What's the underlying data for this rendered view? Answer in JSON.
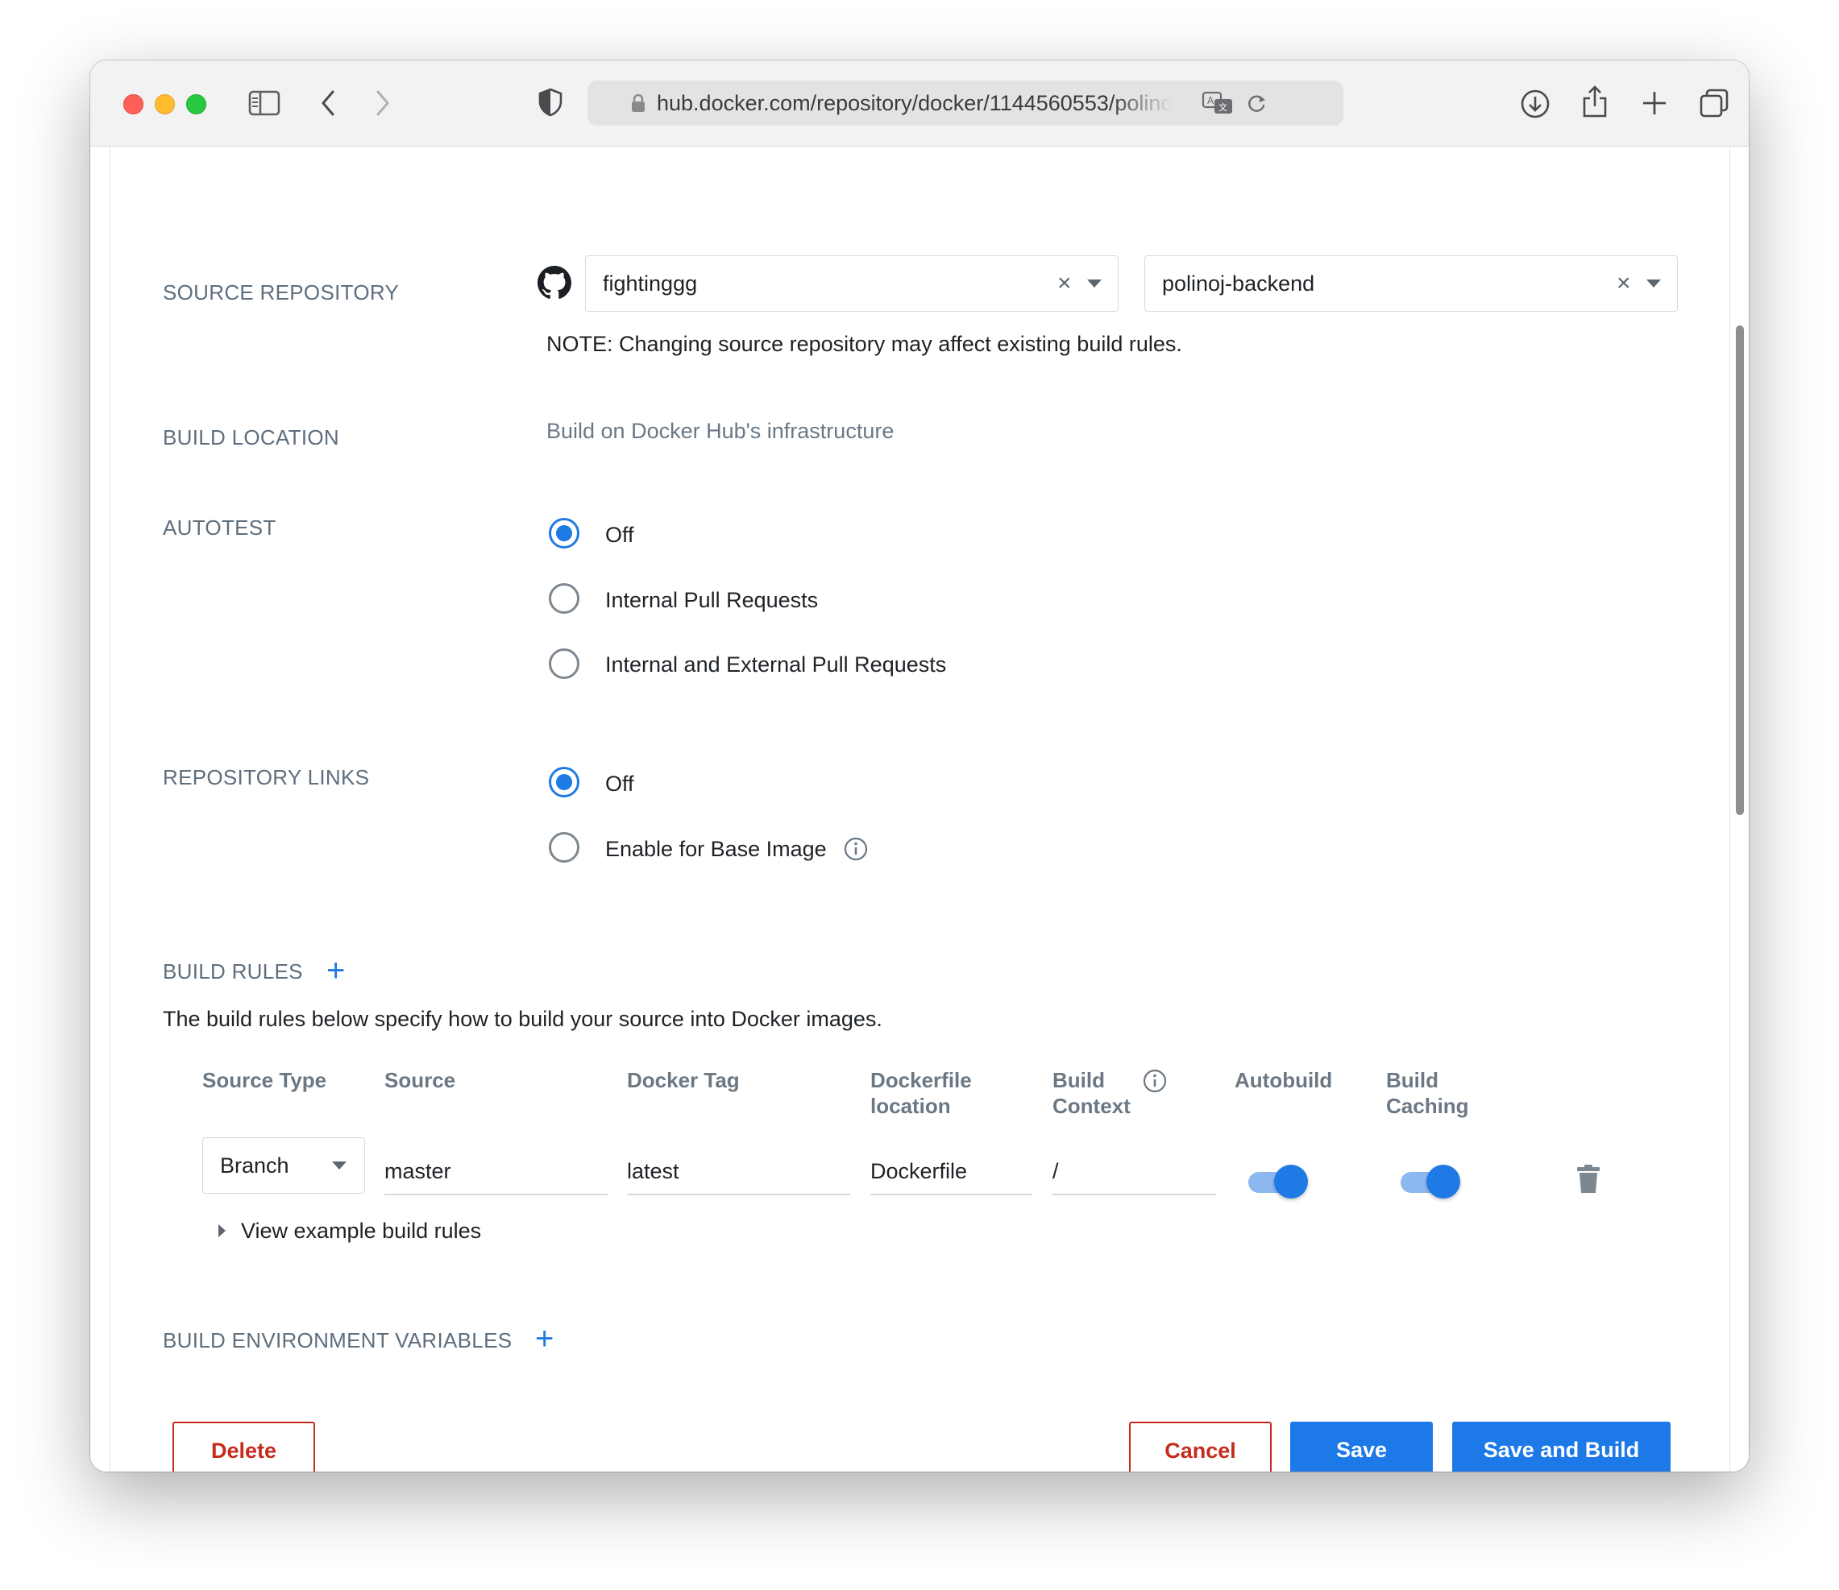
{
  "browser": {
    "url": "hub.docker.com/repository/docker/1144560553/polinoj-backend"
  },
  "source_repository": {
    "label": "SOURCE REPOSITORY",
    "organization": "fightinggg",
    "repository": "polinoj-backend",
    "note": "NOTE: Changing source repository may affect existing build rules."
  },
  "build_location": {
    "label": "BUILD LOCATION",
    "value": "Build on Docker Hub's infrastructure"
  },
  "autotest": {
    "label": "AUTOTEST",
    "options": [
      {
        "label": "Off",
        "selected": true
      },
      {
        "label": "Internal Pull Requests",
        "selected": false
      },
      {
        "label": "Internal and External Pull Requests",
        "selected": false
      }
    ]
  },
  "repository_links": {
    "label": "REPOSITORY LINKS",
    "options": [
      {
        "label": "Off",
        "selected": true
      },
      {
        "label": "Enable for Base Image",
        "selected": false
      }
    ]
  },
  "build_rules": {
    "label": "BUILD RULES",
    "description": "The build rules below specify how to build your source into Docker images.",
    "columns": {
      "source_type": "Source Type",
      "source": "Source",
      "docker_tag": "Docker Tag",
      "dockerfile_location_1": "Dockerfile",
      "dockerfile_location_2": "location",
      "build_context_1": "Build",
      "build_context_2": "Context",
      "autobuild": "Autobuild",
      "build_caching_1": "Build",
      "build_caching_2": "Caching"
    },
    "rows": [
      {
        "source_type": "Branch",
        "source": "master",
        "docker_tag": "latest",
        "dockerfile_location": "Dockerfile",
        "build_context": "/",
        "autobuild": true,
        "build_caching": true
      }
    ],
    "examples_link": "View example build rules"
  },
  "build_env": {
    "label": "BUILD ENVIRONMENT VARIABLES"
  },
  "actions": {
    "delete": "Delete",
    "cancel": "Cancel",
    "save": "Save",
    "save_and_build": "Save and Build"
  },
  "colors": {
    "accent": "#1d79e8",
    "danger": "#c42b1c"
  }
}
